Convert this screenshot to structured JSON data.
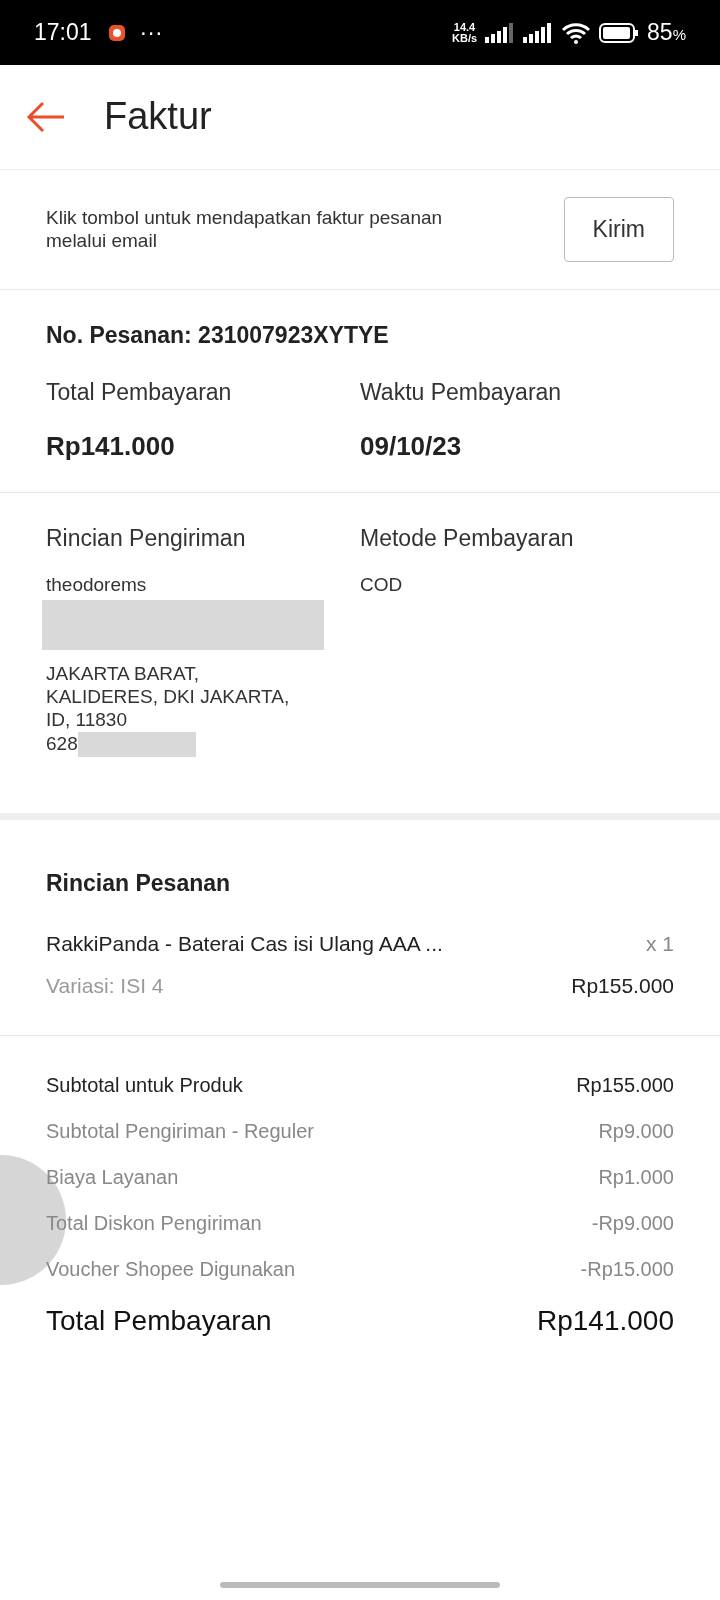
{
  "status_bar": {
    "time": "17:01",
    "more": "···",
    "speed": "14.4",
    "speed_unit": "KB/s",
    "battery": "85",
    "battery_unit": "%"
  },
  "header": {
    "title": "Faktur"
  },
  "email": {
    "text": "Klik tombol untuk mendapatkan faktur pesanan melalui email",
    "button": "Kirim"
  },
  "order": {
    "number": "No. Pesanan: 231007923XYTYE",
    "fields": [
      {
        "label": "Total Pembayaran",
        "value": "Rp141.000"
      },
      {
        "label": "Waktu Pembayaran",
        "value": "09/10/23"
      }
    ]
  },
  "shipping": {
    "label": "Rincian Pengiriman",
    "lines": [
      "theodorems",
      "JAKARTA BARAT,",
      "KALIDERES, DKI JAKARTA,",
      "ID, 11830",
      "628"
    ],
    "payment_label": "Metode Pembayaran",
    "payment_value": "COD"
  },
  "details": {
    "title": "Rincian Pesanan",
    "product": "RakkiPanda - Baterai Cas isi Ulang AAA ...",
    "quantity": "x 1",
    "variant": "Variasi: ISI 4",
    "price": "Rp155.000"
  },
  "summary": [
    {
      "label": "Subtotal untuk Produk",
      "value": "Rp155.000",
      "kind": "primary"
    },
    {
      "label": "Subtotal Pengiriman - Reguler",
      "value": "Rp9.000",
      "kind": "muted"
    },
    {
      "label": "Biaya Layanan",
      "value": "Rp1.000",
      "kind": "muted"
    },
    {
      "label": "Total Diskon Pengiriman",
      "value": "-Rp9.000",
      "kind": "muted"
    },
    {
      "label": "Voucher Shopee Digunakan",
      "value": "-Rp15.000",
      "kind": "muted"
    },
    {
      "label": "Total Pembayaran",
      "value": "Rp141.000",
      "kind": "total"
    }
  ]
}
